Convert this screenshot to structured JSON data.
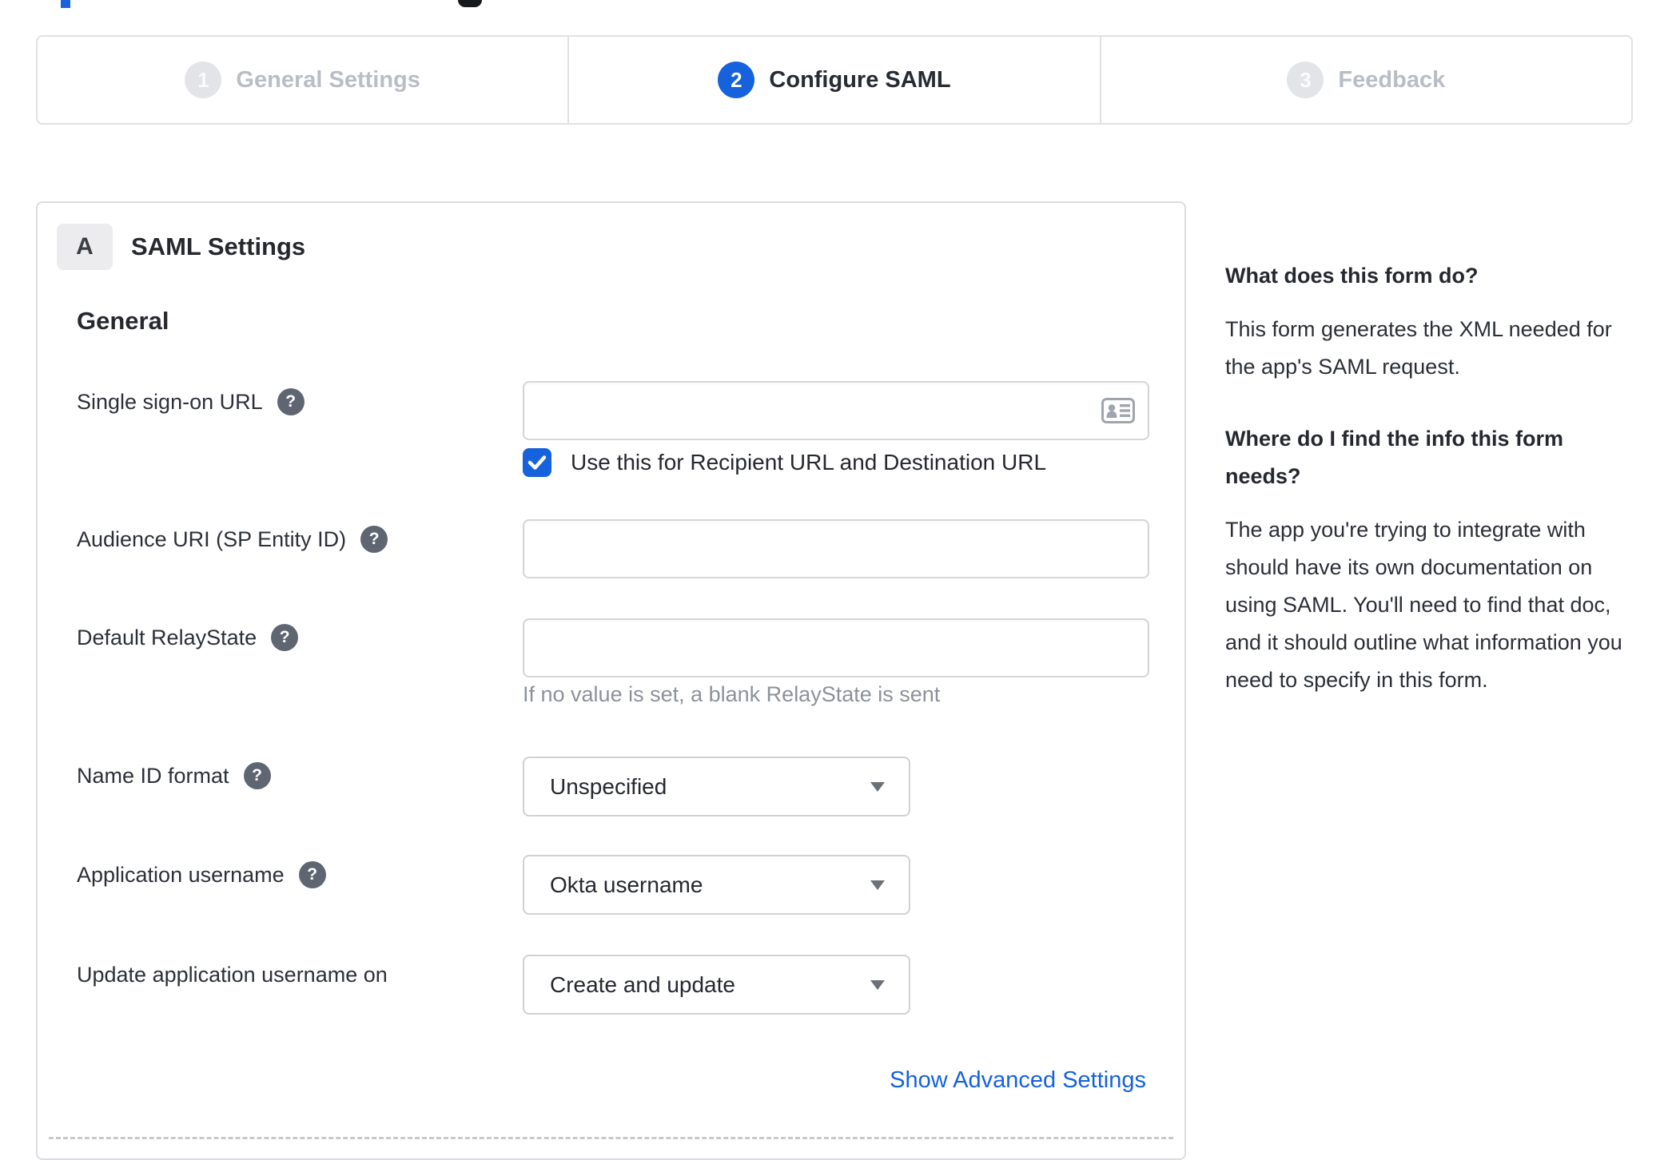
{
  "colors": {
    "accent_blue": "#1662dd",
    "inactive_gray": "#b9bdc5",
    "border_gray": "#dcdde0",
    "hint_gray": "#8c919a"
  },
  "artifacts": {
    "top_left_blue_fragment": "clipped element above viewport",
    "top_dark_fragment": "clipped element above viewport"
  },
  "stepper": {
    "steps": [
      {
        "number": "1",
        "label": "General Settings",
        "state": "inactive"
      },
      {
        "number": "2",
        "label": "Configure SAML",
        "state": "active"
      },
      {
        "number": "3",
        "label": "Feedback",
        "state": "inactive"
      }
    ]
  },
  "panel": {
    "section_badge": "A",
    "section_title": "SAML Settings",
    "group_heading": "General",
    "sso": {
      "label": "Single sign-on URL",
      "value": "",
      "icon": "contact-card",
      "checkbox": {
        "checked": true,
        "label": "Use this for Recipient URL and Destination URL"
      }
    },
    "audience": {
      "label": "Audience URI (SP Entity ID)",
      "value": ""
    },
    "relay": {
      "label": "Default RelayState",
      "value": "",
      "hint": "If no value is set, a blank RelayState is sent"
    },
    "name_id": {
      "label": "Name ID format",
      "value": "Unspecified"
    },
    "app_username": {
      "label": "Application username",
      "value": "Okta username"
    },
    "update_username": {
      "label": "Update application username on",
      "value": "Create and update"
    },
    "advanced_link": "Show Advanced Settings"
  },
  "sidebar": {
    "sections": [
      {
        "heading": "What does this form do?",
        "body": "This form generates the XML needed for the app's SAML request."
      },
      {
        "heading": "Where do I find the info this form needs?",
        "body": "The app you're trying to integrate with should have its own documentation on using SAML. You'll need to find that doc, and it should outline what information you need to specify in this form."
      }
    ]
  }
}
